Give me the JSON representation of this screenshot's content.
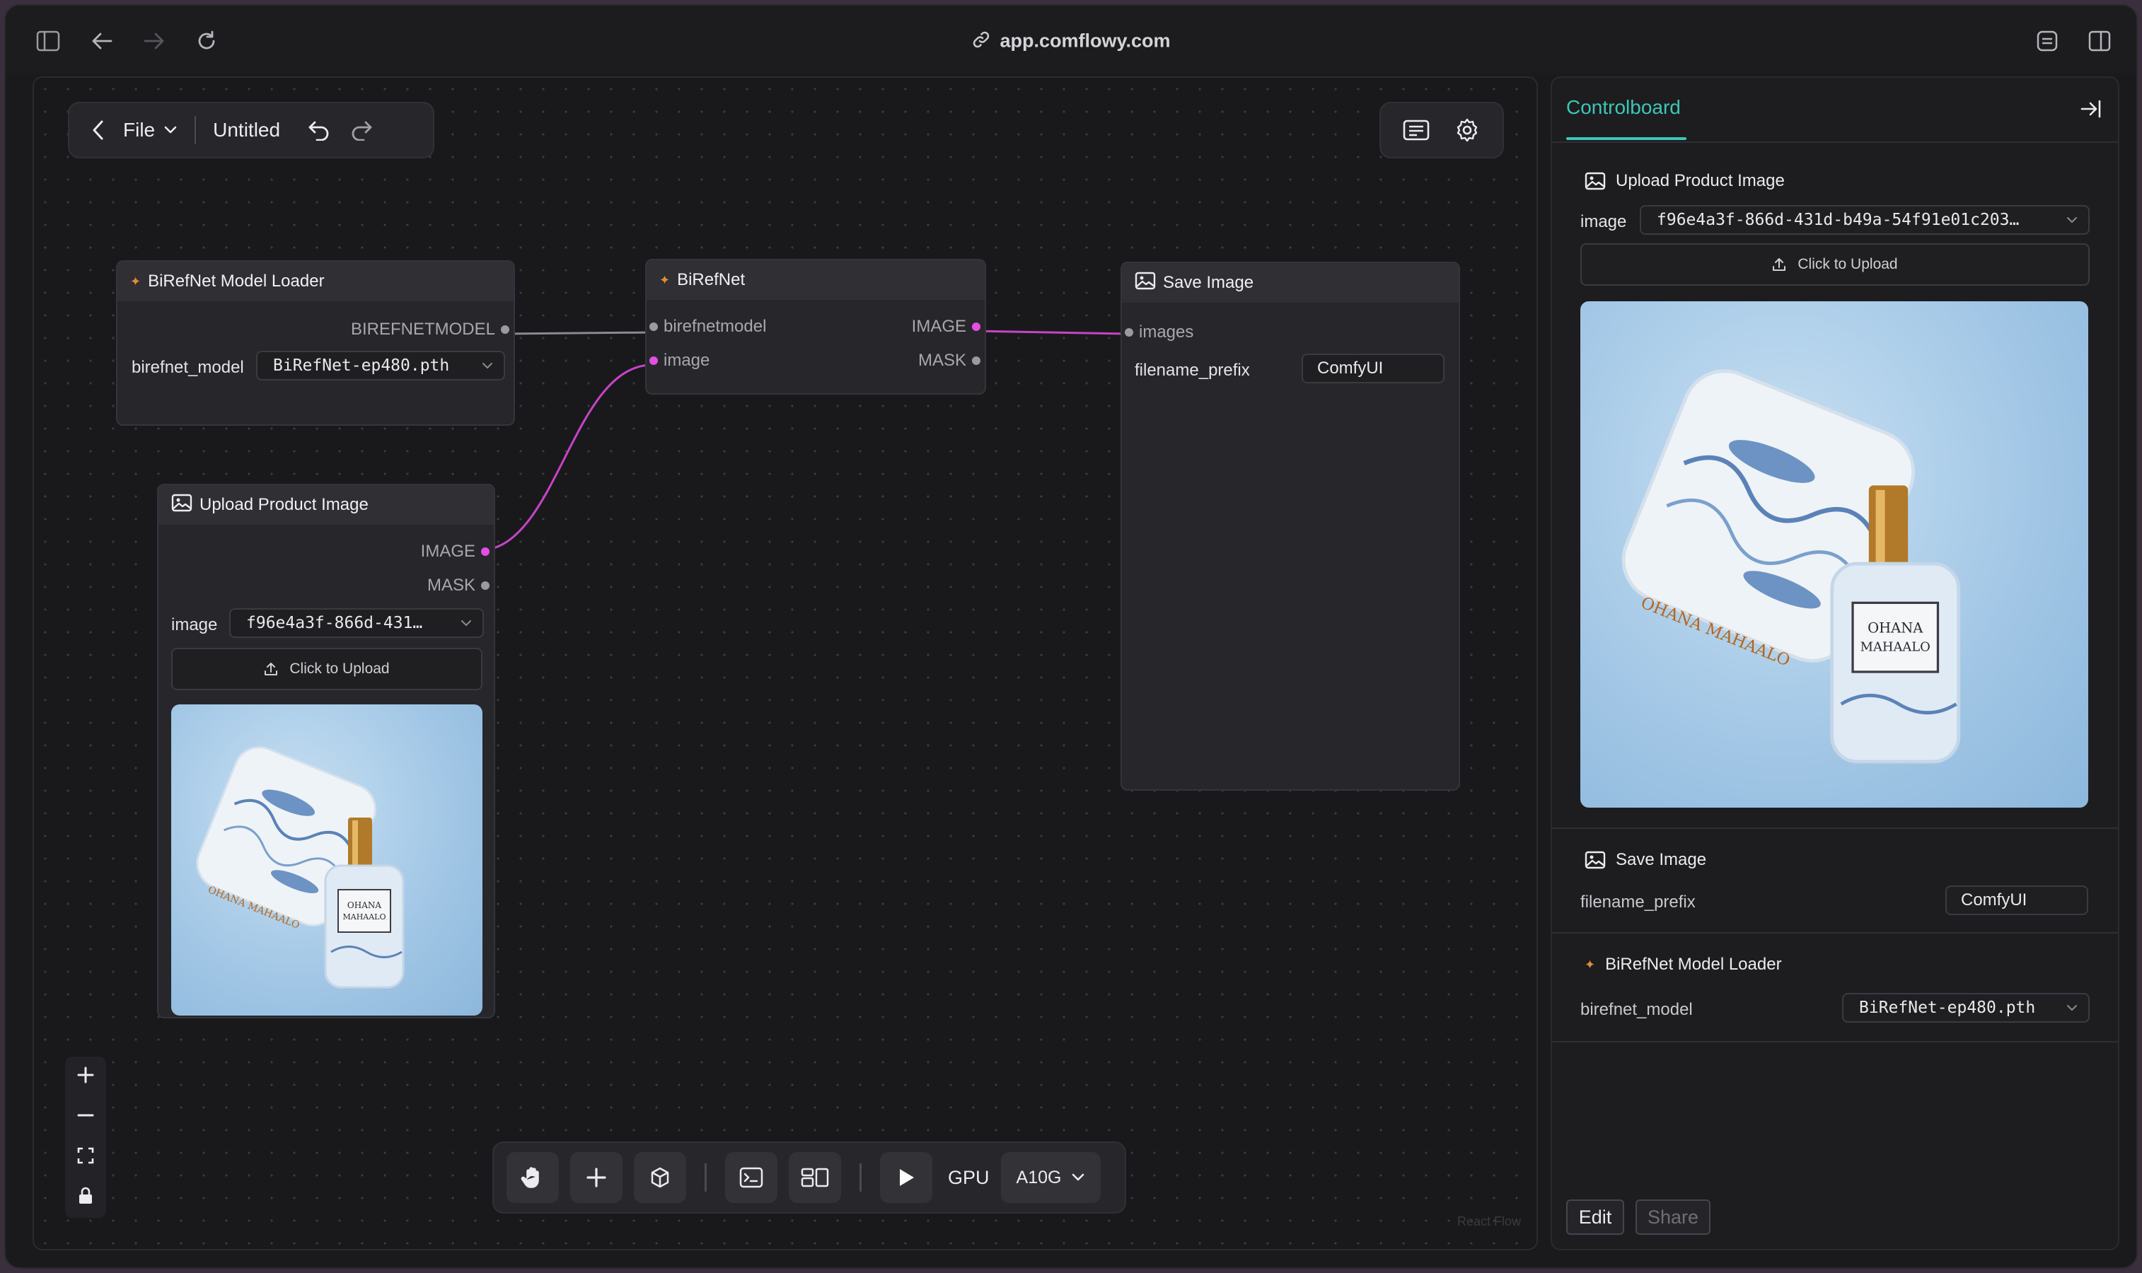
{
  "browser": {
    "url": "app.comflowy.com"
  },
  "file_bar": {
    "file_label": "File",
    "title": "Untitled"
  },
  "nodes": {
    "loader": {
      "title": "BiRefNet Model Loader",
      "output": "BIREFNETMODEL",
      "widget_label": "birefnet_model",
      "widget_value": "BiRefNet-ep480.pth"
    },
    "birefnet": {
      "title": "BiRefNet",
      "inputs": [
        "birefnetmodel",
        "image"
      ],
      "outputs": [
        "IMAGE",
        "MASK"
      ]
    },
    "save": {
      "title": "Save Image",
      "input": "images",
      "widget_label": "filename_prefix",
      "widget_value": "ComfyUI"
    },
    "upload": {
      "title": "Upload Product Image",
      "outputs": [
        "IMAGE",
        "MASK"
      ],
      "widget_label": "image",
      "widget_value": "f96e4a3f-866d-431…",
      "upload_label": "Click to Upload"
    }
  },
  "toolbar": {
    "gpu_label": "GPU",
    "gpu_value": "A10G"
  },
  "react_flow_label": "React Flow",
  "panel": {
    "tab": "Controlboard",
    "upload_section": {
      "title": "Upload Product Image",
      "label": "image",
      "value": "f96e4a3f-866d-431d-b49a-54f91e01c203…",
      "upload_label": "Click to Upload"
    },
    "save_section": {
      "title": "Save Image",
      "label": "filename_prefix",
      "value": "ComfyUI"
    },
    "loader_section": {
      "title": "BiRefNet Model Loader",
      "label": "birefnet_model",
      "value": "BiRefNet-ep480.pth"
    },
    "edit_label": "Edit",
    "share_label": "Share"
  },
  "product_text": [
    "OHANA",
    "MAHAALO",
    "OHANA MAHAALO"
  ],
  "colors": {
    "accent": "#3dc7b3",
    "edge_image": "#e34fe3",
    "edge_model": "#9a9aa0"
  }
}
